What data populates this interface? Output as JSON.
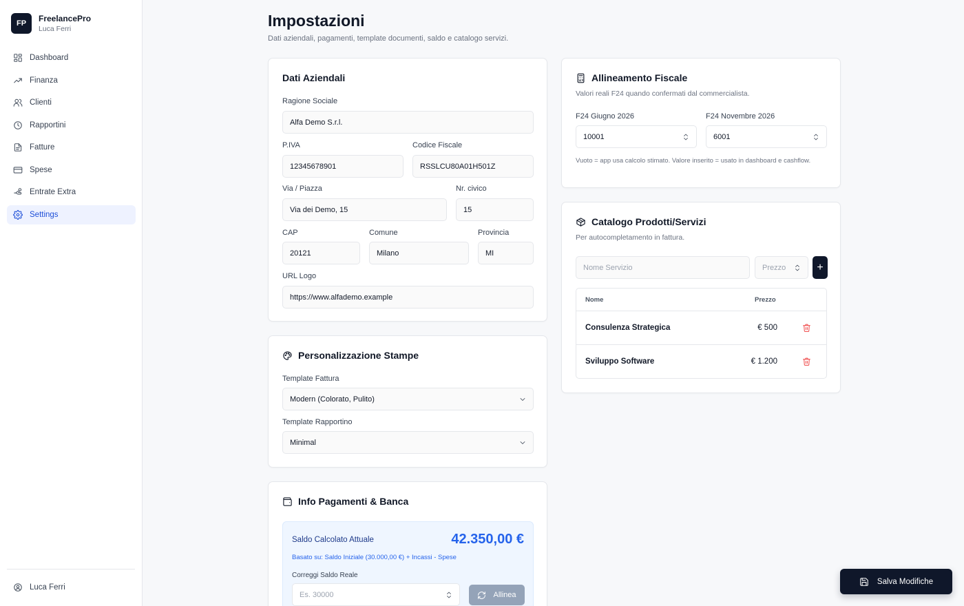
{
  "brand": {
    "logo": "FP",
    "name": "FreelancePro",
    "user": "Luca Ferri"
  },
  "sidebar": {
    "items": [
      {
        "label": "Dashboard",
        "icon": "layout-grid-icon"
      },
      {
        "label": "Finanza",
        "icon": "trending-up-icon"
      },
      {
        "label": "Clienti",
        "icon": "users-icon"
      },
      {
        "label": "Rapportini",
        "icon": "clock-icon"
      },
      {
        "label": "Fatture",
        "icon": "file-text-icon"
      },
      {
        "label": "Spese",
        "icon": "credit-card-icon"
      },
      {
        "label": "Entrate Extra",
        "icon": "hand-coins-icon"
      },
      {
        "label": "Settings",
        "icon": "gear-icon",
        "active": true
      }
    ],
    "footer_user": "Luca Ferri"
  },
  "header": {
    "title": "Impostazioni",
    "subtitle": "Dati aziendali, pagamenti, template documenti, saldo e catalogo servizi."
  },
  "company": {
    "title": "Dati Aziendali",
    "ragione_label": "Ragione Sociale",
    "ragione_value": "Alfa Demo S.r.l.",
    "piva_label": "P.IVA",
    "piva_value": "12345678901",
    "cf_label": "Codice Fiscale",
    "cf_value": "RSSLCU80A01H501Z",
    "via_label": "Via / Piazza",
    "via_value": "Via dei Demo, 15",
    "civico_label": "Nr. civico",
    "civico_value": "15",
    "cap_label": "CAP",
    "cap_value": "20121",
    "comune_label": "Comune",
    "comune_value": "Milano",
    "provincia_label": "Provincia",
    "provincia_value": "MI",
    "logo_label": "URL Logo",
    "logo_value": "https://www.alfademo.example"
  },
  "print": {
    "title": "Personalizzazione Stampe",
    "invoice_label": "Template Fattura",
    "invoice_value": "Modern (Colorato, Pulito)",
    "report_label": "Template Rapportino",
    "report_value": "Minimal"
  },
  "payments": {
    "title": "Info Pagamenti & Banca",
    "balance_label": "Saldo Calcolato Attuale",
    "balance_amount": "42.350,00 €",
    "balance_note": "Basato su: Saldo Iniziale (30.000,00 €) + Incassi - Spese",
    "correct_label": "Correggi Saldo Reale",
    "correct_placeholder": "Es. 30000",
    "align_button": "Allinea"
  },
  "fiscal": {
    "title": "Allineamento Fiscale",
    "subtitle": "Valori reali F24 quando confermati dal commercialista.",
    "june_label": "F24 Giugno 2026",
    "june_value": "10001",
    "nov_label": "F24 Novembre 2026",
    "nov_value": "6001",
    "note": "Vuoto = app usa calcolo stimato. Valore inserito = usato in dashboard e cashflow."
  },
  "catalog": {
    "title": "Catalogo Prodotti/Servizi",
    "subtitle": "Per autocompletamento in fattura.",
    "name_placeholder": "Nome Servizio",
    "price_placeholder": "Prezzo",
    "add_label": "+",
    "col_name": "Nome",
    "col_price": "Prezzo",
    "rows": [
      {
        "name": "Consulenza Strategica",
        "price": "€ 500"
      },
      {
        "name": "Sviluppo Software",
        "price": "€ 1.200"
      }
    ]
  },
  "save_button": "Salva Modifiche"
}
